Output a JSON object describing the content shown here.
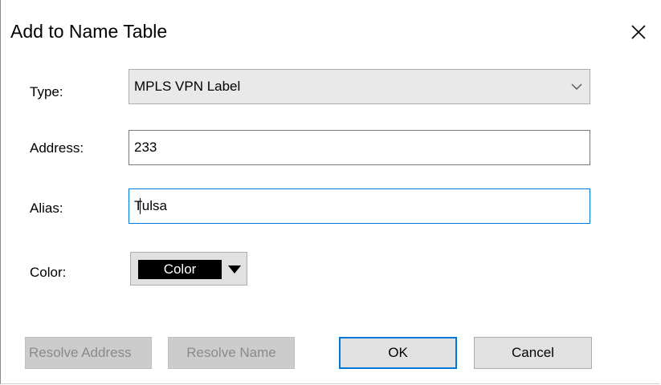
{
  "dialog": {
    "title": "Add to Name Table"
  },
  "form": {
    "type_label": "Type:",
    "type_value": "MPLS VPN Label",
    "address_label": "Address:",
    "address_value": "233",
    "alias_label": "Alias:",
    "alias_value": "Tulsa",
    "color_label": "Color:",
    "color_button_label": "Color",
    "color_swatch": "#000000"
  },
  "buttons": {
    "resolve_address": "Resolve Address",
    "resolve_name": "Resolve Name",
    "ok": "OK",
    "cancel": "Cancel"
  },
  "icons": {
    "close": "close-icon",
    "dropdown": "chevron-down-icon",
    "color_dropdown": "triangle-down-icon"
  },
  "colors": {
    "focus": "#0078d7",
    "disabled_text": "#8a8a8a"
  }
}
